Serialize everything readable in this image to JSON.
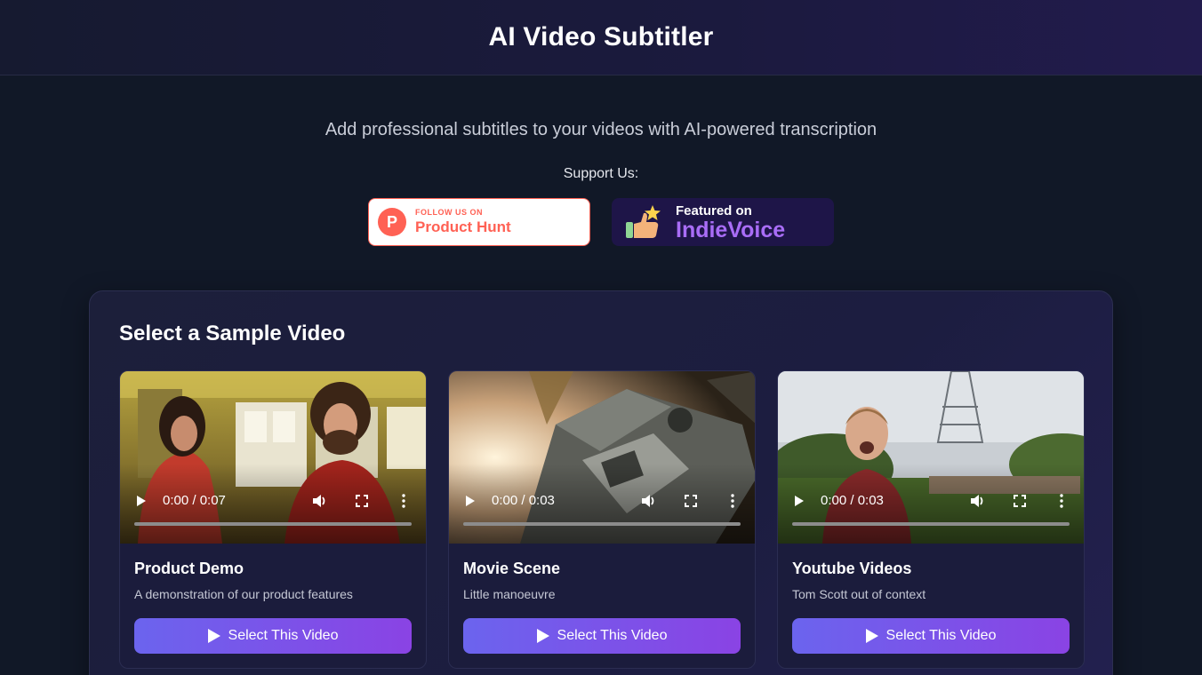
{
  "header": {
    "title": "AI Video Subtitler"
  },
  "subtitle": "Add professional subtitles to your videos with AI-powered transcription",
  "support": {
    "label": "Support Us:",
    "product_hunt": {
      "small": "FOLLOW US ON",
      "big": "Product Hunt",
      "logo_letter": "P"
    },
    "indievoice": {
      "small": "Featured on",
      "big": "IndieVoice"
    }
  },
  "samples": {
    "title": "Select a Sample Video",
    "videos": [
      {
        "time": "0:00 / 0:07",
        "title": "Product Demo",
        "description": "A demonstration of our product features",
        "button": "Select This Video"
      },
      {
        "time": "0:00 / 0:03",
        "title": "Movie Scene",
        "description": "Little manoeuvre",
        "button": "Select This Video"
      },
      {
        "time": "0:00 / 0:03",
        "title": "Youtube Videos",
        "description": "Tom Scott out of context",
        "button": "Select This Video"
      }
    ]
  },
  "colors": {
    "accent_start": "#6b64ee",
    "accent_end": "#8a43e4",
    "product_hunt": "#ff6154",
    "indievoice": "#a96df7",
    "background": "#111827"
  }
}
